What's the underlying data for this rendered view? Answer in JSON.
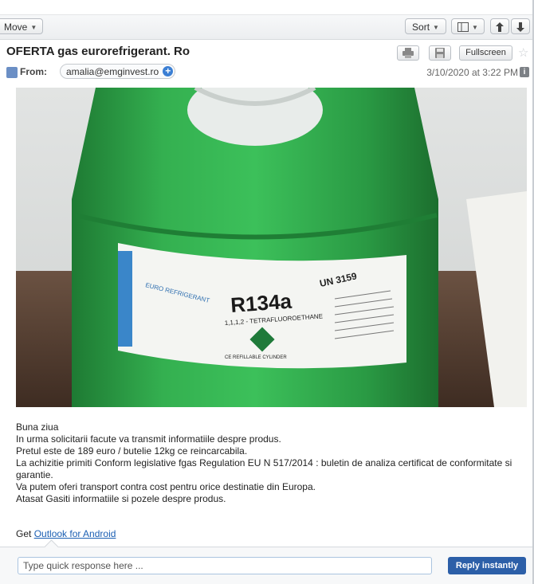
{
  "toolbar": {
    "move_label": "Move",
    "sort_label": "Sort",
    "layout_icon": "column-layout-icon",
    "up_icon": "arrow-up-icon",
    "down_icon": "arrow-down-icon"
  },
  "message": {
    "subject": "OFERTA gas eurorefrigerant. Ro",
    "fullscreen_label": "Fullscreen",
    "from_label": "From:",
    "from_address": "amalia@emginvest.ro",
    "date": "3/10/2020 at 3:22 PM"
  },
  "photo": {
    "cylinder_label_product": "R134a",
    "cylinder_label_name": "1,1,1,2 - TETRAFLUOROETHANE",
    "cylinder_label_un": "UN 3159",
    "cylinder_label_brand": "EURO REFRIGERANT",
    "cylinder_label_footer": "CE REFILLABLE CYLINDER"
  },
  "body": {
    "lines": [
      "Buna ziua",
      "In urma solicitarii facute va transmit informatiile despre produs.",
      "Pretul este de 189 euro / butelie 12kg ce reincarcabila.",
      "La achizitie primiti Conform legislative fgas Regulation EU N 517/2014 : buletin de analiza certificat de conformitate si garantie.",
      "Va putem oferi transport contra cost pentru orice destinatie din Europa.",
      "Atasat Gasiti informatiile si pozele despre produs."
    ],
    "signature_prefix": "Get ",
    "signature_link": "Outlook for Android"
  },
  "reply": {
    "placeholder": "Type quick response here ...",
    "button_label": "Reply instantly"
  },
  "colors": {
    "accent": "#2c5fa8",
    "cylinder_green": "#2fa84a",
    "link": "#1b5fb3"
  }
}
